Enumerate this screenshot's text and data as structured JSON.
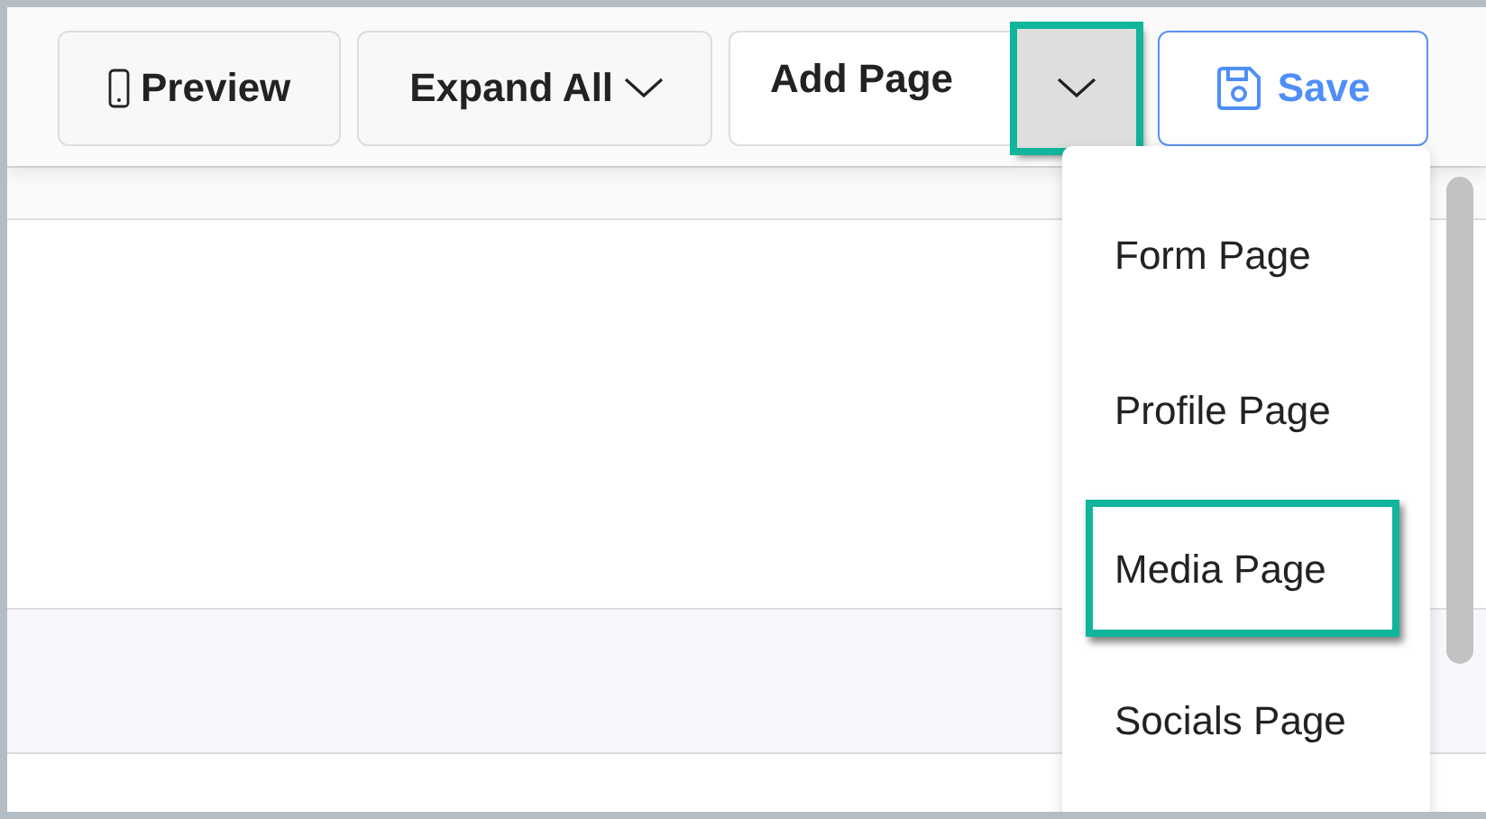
{
  "toolbar": {
    "buttons": [
      {
        "kind": "preview",
        "label": "Preview"
      },
      {
        "kind": "expand",
        "label": "Expand All"
      },
      {
        "kind": "split",
        "label": "Add Page",
        "caret_highlighted": true
      },
      {
        "kind": "save",
        "label": "Save"
      }
    ]
  },
  "add_page_menu": {
    "items": [
      {
        "label": "Form Page",
        "highlighted": false
      },
      {
        "label": "Profile Page",
        "highlighted": false
      },
      {
        "label": "Media Page",
        "highlighted": true
      },
      {
        "label": "Socials Page",
        "highlighted": false
      }
    ]
  }
}
